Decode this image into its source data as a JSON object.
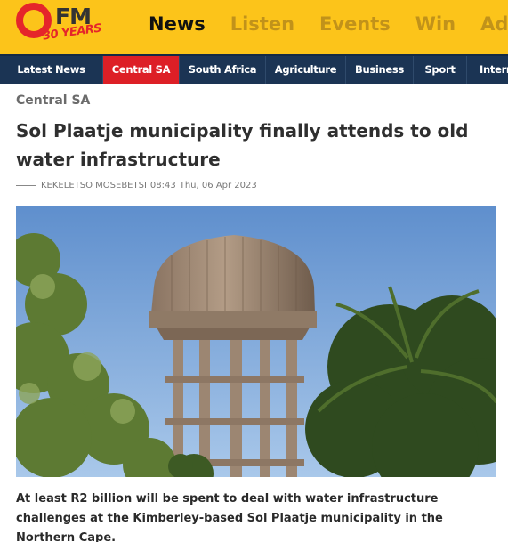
{
  "header": {
    "logo_fm": "FM",
    "logo_years": "30 YEARS",
    "nav": [
      {
        "label": "News",
        "active": true
      },
      {
        "label": "Listen",
        "active": false
      },
      {
        "label": "Events",
        "active": false
      },
      {
        "label": "Win",
        "active": false
      },
      {
        "label": "Adver",
        "active": false
      }
    ]
  },
  "categories": [
    {
      "label": "Latest News",
      "active": false
    },
    {
      "label": "Central SA",
      "active": true
    },
    {
      "label": "South Africa",
      "active": false
    },
    {
      "label": "Agriculture",
      "active": false
    },
    {
      "label": "Business",
      "active": false
    },
    {
      "label": "Sport",
      "active": false
    },
    {
      "label": "Intern",
      "active": false
    }
  ],
  "article": {
    "category": "Central SA",
    "title": "Sol Plaatje municipality finally attends to old water infrastructure",
    "author": "KEKELETSO MOSEBETSI",
    "time": "08:43",
    "date": "Thu, 06 Apr 2023",
    "lead": "At least R2 billion will be spent to deal with water infrastructure challenges at the Kimberley-based Sol Plaatje municipality in the Northern Cape."
  },
  "colors": {
    "header_yellow": "#fcc41a",
    "nav_navy": "#1b3454",
    "active_red": "#dd1f26"
  }
}
